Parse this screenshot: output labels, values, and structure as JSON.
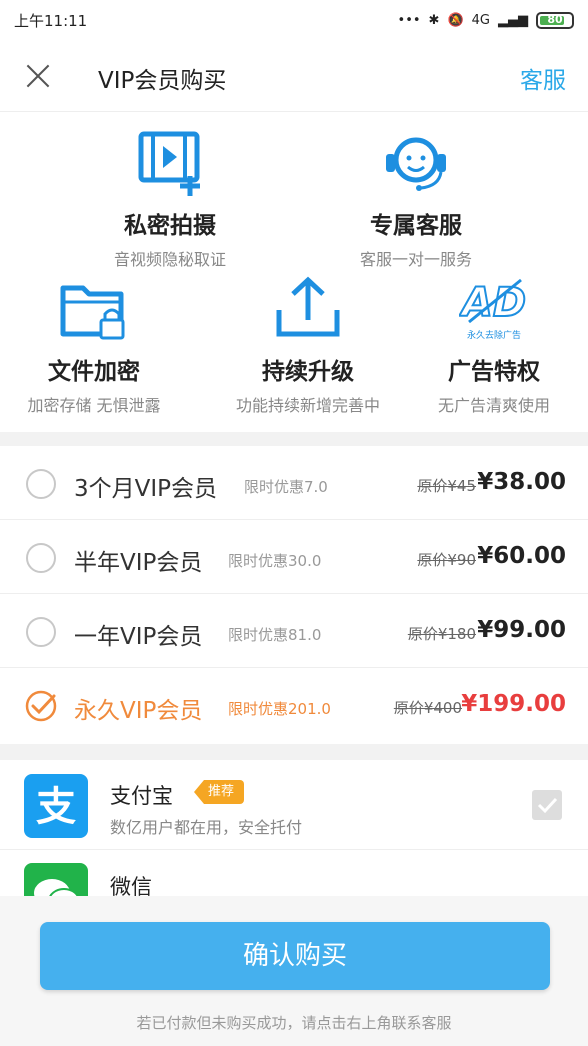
{
  "status": {
    "time": "上午11:11",
    "network": "4G",
    "battery_level": 0.8,
    "battery_text": "80"
  },
  "header": {
    "title": "VIP会员购买",
    "service_label": "客服"
  },
  "features": [
    {
      "title": "私密拍摄",
      "subtitle": "音视频隐秘取证",
      "icon": "video-record-icon"
    },
    {
      "title": "专属客服",
      "subtitle": "客服一对一服务",
      "icon": "headset-icon"
    },
    {
      "title": "文件加密",
      "subtitle": "加密存储 无惧泄露",
      "icon": "locked-folder-icon"
    },
    {
      "title": "持续升级",
      "subtitle": "功能持续新增完善中",
      "icon": "upload-icon"
    },
    {
      "title": "广告特权",
      "subtitle": "无广告清爽使用",
      "icon": "ad-free-icon",
      "icon_caption": "永久去除广告"
    }
  ],
  "plans": [
    {
      "name": "3个月VIP会员",
      "promo": "限时优惠7.0",
      "original": "原价¥45",
      "price": "¥38.00",
      "selected": false
    },
    {
      "name": "半年VIP会员",
      "promo": "限时优惠30.0",
      "original": "原价¥90",
      "price": "¥60.00",
      "selected": false
    },
    {
      "name": "一年VIP会员",
      "promo": "限时优惠81.0",
      "original": "原价¥180",
      "price": "¥99.00",
      "selected": false
    },
    {
      "name": "永久VIP会员",
      "promo": "限时优惠201.0",
      "original": "原价¥400",
      "price": "¥199.00",
      "selected": true
    }
  ],
  "payment": [
    {
      "name": "支付宝",
      "badge": "推荐",
      "subtitle": "数亿用户都在用，安全托付",
      "logo_glyph": "支",
      "icon": "alipay-icon",
      "color": "#1a9ff0",
      "checked": true
    },
    {
      "name": "微信",
      "icon": "wechat-icon",
      "color": "#21b34a"
    }
  ],
  "confirm_label": "确认购买",
  "footer_note": "若已付款但未购买成功，请点击右上角联系客服",
  "colors": {
    "accent_blue": "#2aa8e8",
    "button_blue": "#45b0ee",
    "selected_orange": "#f08a3c",
    "price_red": "#e83e3e"
  }
}
